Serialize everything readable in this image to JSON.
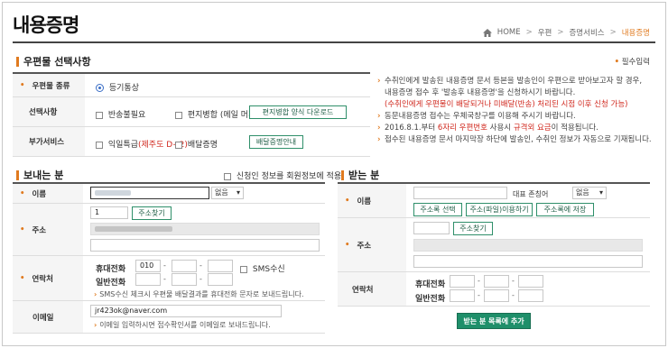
{
  "page_title": "내용증명",
  "breadcrumb": {
    "home": "HOME",
    "sep": ">",
    "items": [
      "우편",
      "증명서비스",
      "내용증명"
    ]
  },
  "section1": {
    "title": "우편물 선택사항",
    "required_note": "필수입력",
    "mail_type": {
      "label": "우편물 종류",
      "option": "등기통상"
    },
    "options": {
      "label": "선택사항",
      "return_unneeded": "반송불필요",
      "letter_merge": "편지병합 (메일 머지)",
      "download_button": "편지병합 양식 다운로드"
    },
    "addl": {
      "label": "부가서비스",
      "express": "익일특급",
      "express_note": "(제주도 D+2)",
      "delivery_proof": "배달증명",
      "delivery_info_button": "배달증명안내"
    }
  },
  "info": {
    "lines": [
      "수취인에게 발송된 내용증명 문서 등본을 발송인이 우편으로 받아보고자 할 경우,",
      "내용증명 접수 후 '발송후 내용증명'을 신청하시기 바랍니다.",
      "(수취인에게 우편물이 배달되거나 미배달(반송) 처리된 시점 이후 신청 가능)",
      "동문내용증명 접수는 우체국창구를 이용해 주시기 바랍니다.",
      "2016.8.1.부터 ",
      "6자리 우편번호",
      " 사용시 ",
      "규격외 요금",
      "이 적용됩니다.",
      "접수된 내용증명 문서 마지막장 하단에 발송인, 수취인 정보가 자동으로 기재됩니다."
    ]
  },
  "sender": {
    "title": "보내는 분",
    "apply_member": "신청인 정보를 회원정보에 적용",
    "name_label": "이름",
    "title_select": "없음",
    "address_label": "주소",
    "zip_value": "1",
    "find_address_button": "주소찾기",
    "contact_label": "연락처",
    "mobile_label": "휴대전화",
    "mobile_prefix": "010",
    "dash": "-",
    "sms_label": "SMS수신",
    "phone_label": "일반전화",
    "sms_note": "SMS수신 체크시 우편물 배달결과를 휴대전화 문자로 보내드립니다.",
    "email_label": "이메일",
    "email_value": "jr423ok@naver.com",
    "email_note": "이메일 입력하시면 접수확인서를 이메일로 보내드립니다."
  },
  "receiver": {
    "title": "받는 분",
    "name_label": "이름",
    "rep_label": "대표 존칭어",
    "rep_select": "없음",
    "addr_select_button": "주소록 선택",
    "addr_file_button": "주소(파일)이용하기",
    "addr_save_button": "주소록에 저장",
    "address_label": "주소",
    "find_address_button": "주소찾기",
    "contact_label": "연락처",
    "mobile_label": "휴대전화",
    "phone_label": "일반전화",
    "dash": "-",
    "add_button": "받는 분 목록에 추가"
  }
}
